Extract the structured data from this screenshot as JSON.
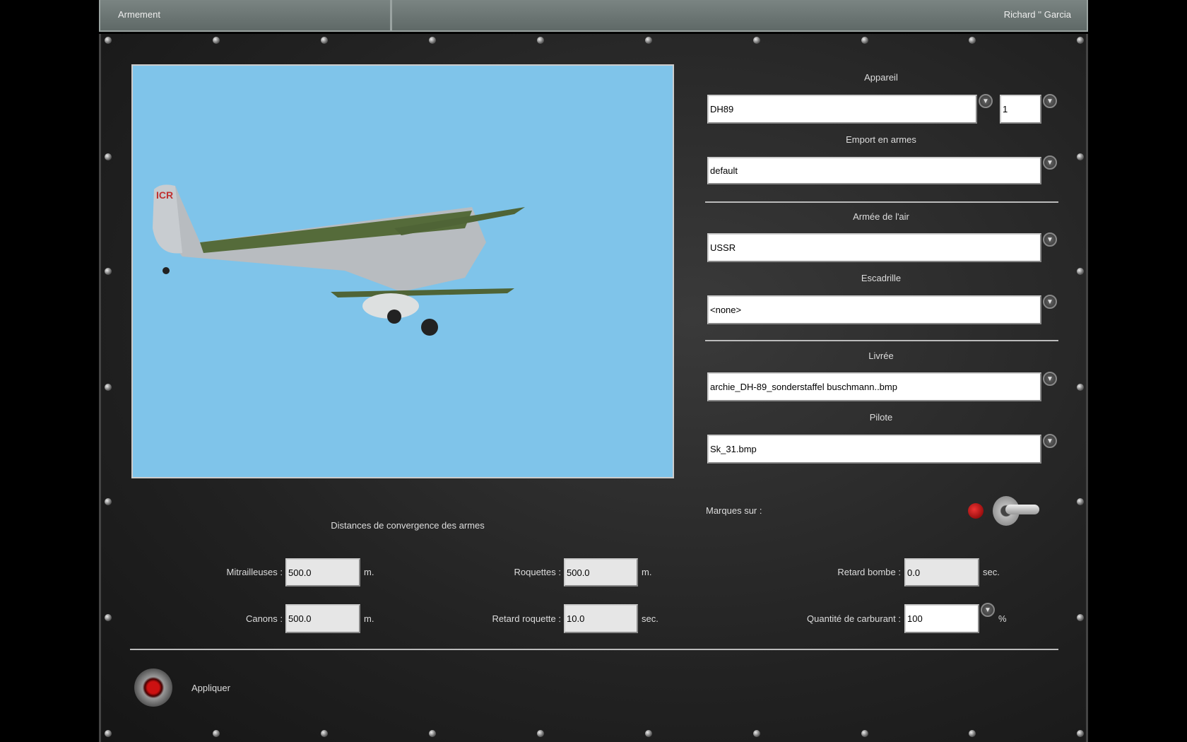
{
  "header": {
    "title": "Armement",
    "user": "Richard '' Garcia"
  },
  "aircraft": {
    "label": "Appareil",
    "value": "DH89",
    "count": "1"
  },
  "loadout": {
    "label": "Emport en armes",
    "value": "default"
  },
  "airforce": {
    "label": "Armée de l'air",
    "value": "USSR"
  },
  "squadron": {
    "label": "Escadrille",
    "value": "<none>"
  },
  "skin": {
    "label": "Livrée",
    "value": "archie_DH-89_sonderstaffel buschmann..bmp"
  },
  "pilot": {
    "label": "Pilote",
    "value": "Sk_31.bmp"
  },
  "markings": {
    "label": "Marques sur :"
  },
  "convergence": {
    "title": "Distances de convergence des armes",
    "mg": {
      "label": "Mitrailleuses :",
      "value": "500.0",
      "unit": "m."
    },
    "cannon": {
      "label": "Canons :",
      "value": "500.0",
      "unit": "m."
    },
    "rockets": {
      "label": "Roquettes :",
      "value": "500.0",
      "unit": "m."
    },
    "rocket_delay": {
      "label": "Retard roquette :",
      "value": "10.0",
      "unit": "sec."
    },
    "bomb_delay": {
      "label": "Retard bombe :",
      "value": "0.0",
      "unit": "sec."
    },
    "fuel": {
      "label": "Quantité de carburant :",
      "value": "100",
      "unit": "%"
    }
  },
  "apply": {
    "label": "Appliquer"
  }
}
